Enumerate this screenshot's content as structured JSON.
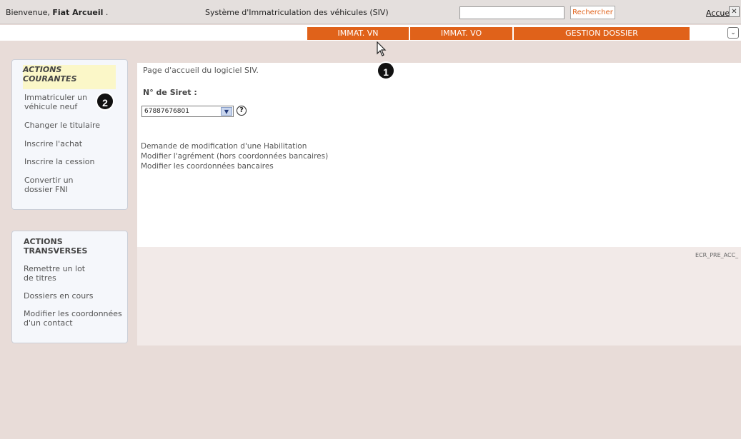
{
  "header": {
    "welcome_prefix": "Bienvenue, ",
    "user_name": "Fiat Arcueil",
    "welcome_suffix": " .",
    "app_title": "Système d'Immatriculation des véhicules (SIV)",
    "search_value": "",
    "search_button": "Rechercher",
    "home_link": "Accueil",
    "close_icon": "close-icon"
  },
  "nav": {
    "tabs": [
      {
        "label": "IMMAT. VN"
      },
      {
        "label": "IMMAT. VO"
      },
      {
        "label": "GESTION DOSSIER"
      }
    ],
    "collapse_icon": "chevron-down-icon"
  },
  "sidebar": {
    "courantes": {
      "title_line1": "ACTIONS",
      "title_line2": "COURANTES",
      "items": [
        {
          "line1": "Immatriculer un",
          "line2": "véhicule neuf"
        },
        {
          "line1": "Changer le titulaire",
          "line2": ""
        },
        {
          "line1": "Inscrire l'achat",
          "line2": ""
        },
        {
          "line1": "Inscrire la cession",
          "line2": ""
        },
        {
          "line1": "Convertir un",
          "line2": "dossier FNI"
        }
      ]
    },
    "transverses": {
      "title_line1": "ACTIONS",
      "title_line2": "TRANSVERSES",
      "items": [
        {
          "line1": "Remettre un lot",
          "line2": "de titres"
        },
        {
          "line1": "Dossiers en cours",
          "line2": ""
        },
        {
          "line1": "Modifier les coordonnées",
          "line2": "d'un contact"
        }
      ]
    }
  },
  "main": {
    "intro": "Page d'accueil du logiciel SIV.",
    "siret_label": "N° de Siret :",
    "siret_value": "67887676801",
    "help_icon": "help-icon",
    "links": [
      "Demande de modification d'une Habilitation",
      "Modifier l'agrément (hors coordonnées bancaires)",
      "Modifier les coordonnées bancaires"
    ],
    "screen_code": "ECR_PRE_ACC_"
  },
  "annotations": {
    "badge1": "1",
    "badge2": "2"
  },
  "colors": {
    "accent": "#e0621a",
    "background": "#e8dcd8",
    "panel": "#ffffff"
  }
}
